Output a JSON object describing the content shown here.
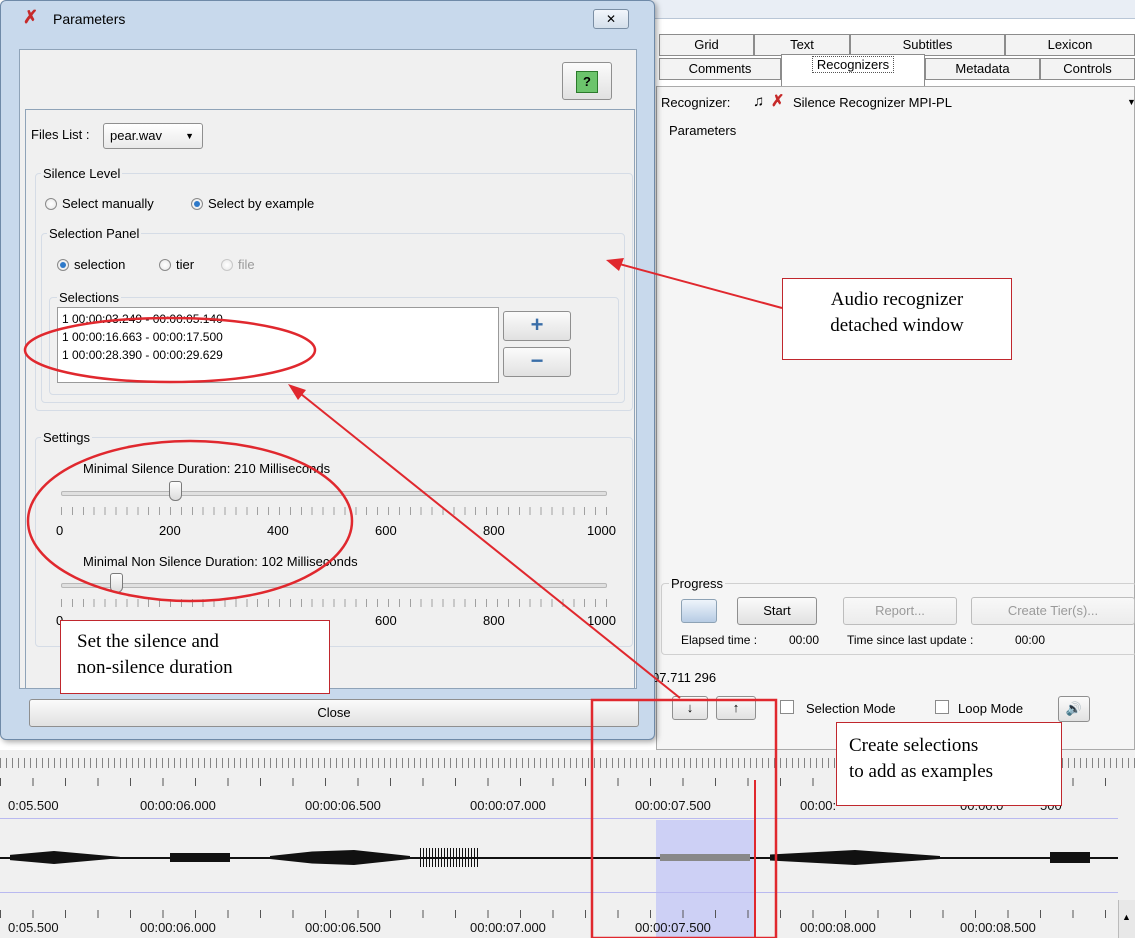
{
  "dialog": {
    "title": "Parameters",
    "help_icon": "help-icon",
    "files_list_label": "Files List :",
    "files_list_value": "pear.wav",
    "silence_level": {
      "title": "Silence Level",
      "option_manual": "Select manually",
      "option_example": "Select by example",
      "selected": "Select by example"
    },
    "selection_panel": {
      "title": "Selection Panel",
      "options": [
        "selection",
        "tier",
        "file"
      ],
      "selected": "selection"
    },
    "selections": {
      "title": "Selections",
      "items": [
        "1 00:00:03.249 - 00:00:05.140",
        "1 00:00:16.663 - 00:00:17.500",
        "1 00:00:28.390 - 00:00:29.629"
      ],
      "add_label": "+",
      "remove_label": "−"
    },
    "settings": {
      "title": "Settings",
      "slider1_label": "Minimal Silence Duration: 210 Milliseconds",
      "slider1_value": 210,
      "slider2_label": "Minimal Non Silence Duration: 102 Milliseconds",
      "slider2_value": 102,
      "slider_min": 0,
      "slider_max": 1000,
      "ticks": [
        "0",
        "200",
        "400",
        "600",
        "800",
        "1000"
      ]
    },
    "close_label": "Close"
  },
  "main": {
    "tabs_row1": [
      "Grid",
      "Text",
      "Subtitles",
      "Lexicon"
    ],
    "tabs_row2": [
      "Comments",
      "Recognizers",
      "Metadata",
      "Controls"
    ],
    "active_tab": "Recognizers",
    "recognizer_label": "Recognizer:",
    "recognizer_value": "Silence Recognizer MPI-PL",
    "parameters_label": "Parameters",
    "progress": {
      "title": "Progress",
      "start": "Start",
      "report": "Report...",
      "create_tiers": "Create Tier(s)...",
      "elapsed_label": "Elapsed time :",
      "elapsed_value": "00:00",
      "since_label": "Time since last update :",
      "since_value": "00:00"
    },
    "status_numbers": "07.711  296",
    "selection_mode": "Selection Mode",
    "loop_mode": "Loop Mode"
  },
  "timeline": {
    "top_labels": [
      "0:05.500",
      "00:00:06.000",
      "00:00:06.500",
      "00:00:07.000",
      "00:00:07.500",
      "00:00:08.000",
      "00:00:08.500"
    ],
    "top_visible": [
      "0:05.500",
      "00:00:06.000",
      "00:00:06.500",
      "00:00:07.000",
      "00:00:07.500",
      "00:00:",
      "00:00:0",
      "500"
    ],
    "bottom_labels": [
      "0:05.500",
      "00:00:06.000",
      "00:00:06.500",
      "00:00:07.000",
      "00:00:07.500",
      "00:00:08.000",
      "00:00:08.500"
    ]
  },
  "annotations": {
    "callout_audio": [
      "Audio recognizer",
      "detached window"
    ],
    "callout_settings": [
      "Set the silence and",
      "non-silence duration"
    ],
    "callout_selections": [
      "Create selections",
      "to add as examples"
    ]
  },
  "colors": {
    "dialog_frame": "#c8d9ec",
    "annotation_red": "#e0282e",
    "selection_highlight": "#cdd0f5"
  }
}
